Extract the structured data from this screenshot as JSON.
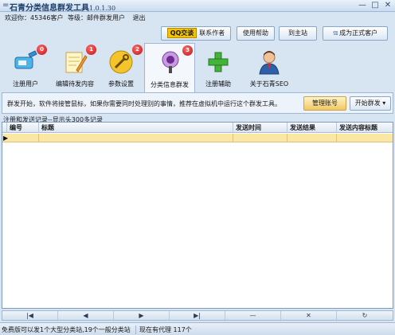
{
  "window": {
    "menu_glyph": "=",
    "title": "石青分类信息群发工具",
    "version": "1.0.1.30",
    "min_glyph": "—",
    "max_glyph": "□",
    "close_glyph": "✕"
  },
  "welcome": {
    "greeting": "欢迎你：45346客户",
    "level": "等级：邮件群发用户",
    "logout": "退出"
  },
  "topbar": {
    "qq_badge": "QQ交谈",
    "contact_author": "联系作者",
    "help": "使用帮助",
    "home": "到主站",
    "official_prefix": "ℼ",
    "official": "成为正式客户"
  },
  "toolbar": {
    "items": [
      {
        "label": "注册用户",
        "badge": "0",
        "icon": "register-user-icon"
      },
      {
        "label": "编辑待发内容",
        "badge": "1",
        "icon": "edit-content-icon"
      },
      {
        "label": "参数设置",
        "badge": "2",
        "icon": "settings-icon"
      },
      {
        "label": "分类信息群发",
        "badge": "3",
        "icon": "broadcast-icon"
      },
      {
        "label": "注册辅助",
        "icon": "add-icon"
      },
      {
        "label": "关于石青SEO",
        "icon": "user-avatar-icon"
      }
    ]
  },
  "infobar": {
    "text": "群发开始，软件将接管鼠标，如果你需要同时处理别的事情，推荐在虚拟机中运行这个群发工具。",
    "manage_account": "管理账号",
    "start_send": "开始群发",
    "start_arrow": "▾"
  },
  "records": {
    "label": "注册和发送记录--显示头300多记录",
    "columns": [
      "编号",
      "标题",
      "发送时间",
      "发送结果",
      "发送内容标题"
    ],
    "row_pointer": "▶"
  },
  "navigator": {
    "buttons": [
      "|◀",
      "◀",
      "▶",
      "▶|",
      "—",
      "✕",
      "↻"
    ]
  },
  "status": {
    "left": "免费版可以发1个大型分类站,19个一般分类站",
    "right": "现在有代理 117个"
  },
  "colors": {
    "badge_red": "#c11010",
    "row_highlight": "#fbe7a4",
    "manage_button": "#f2c75f"
  }
}
